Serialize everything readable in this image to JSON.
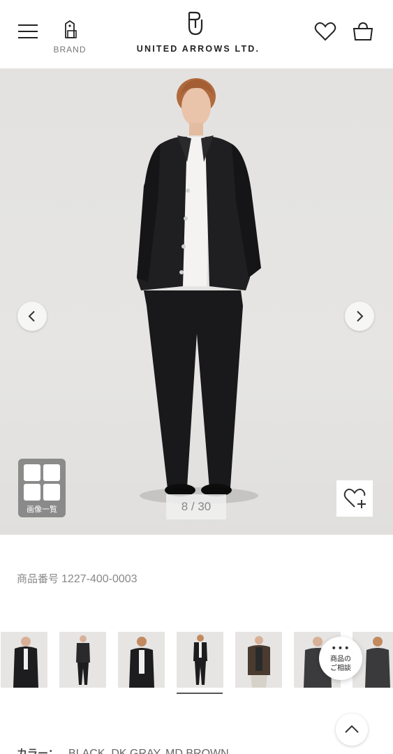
{
  "header": {
    "brand_label": "BRAND",
    "logo_text": "UNITED ARROWS LTD.",
    "icons": [
      "menu-icon",
      "shopping-tag-icon",
      "logo-mark-icon",
      "heart-icon",
      "shopping-bag-icon"
    ]
  },
  "hero": {
    "image_subject": "model in black shirt jacket and black trousers",
    "counter": "8 / 30",
    "grid_label": "画像一覧",
    "icons": [
      "chevron-left-icon",
      "chevron-right-icon",
      "grid-icon",
      "heart-plus-icon"
    ]
  },
  "product": {
    "number_label": "商品番号",
    "number_value": "1227-400-0003"
  },
  "thumbnails": {
    "count_visible": 7,
    "selected_index": 3
  },
  "chat": {
    "dots": "•••",
    "label": "商品の\nご相談"
  },
  "color": {
    "label": "カラー：",
    "value": "BLACK, DK.GRAY, MD.BROWN"
  },
  "colors": {
    "background": "#ffffff",
    "hero_bg": "#e4e3e1",
    "text_main": "#222222",
    "text_muted": "#888888"
  }
}
